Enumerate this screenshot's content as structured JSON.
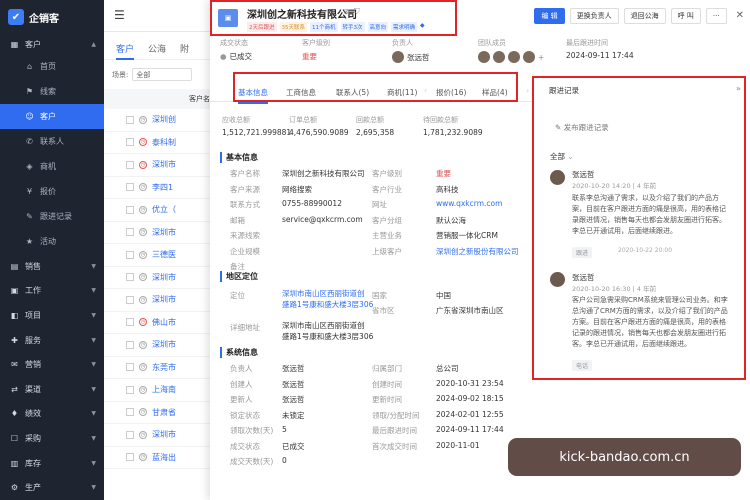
{
  "app": {
    "name": "企销客"
  },
  "sidebar": {
    "sections_top": [
      {
        "label": "客户"
      }
    ],
    "items": [
      {
        "label": "首页",
        "icon": "home-icon"
      },
      {
        "label": "线索",
        "icon": "lead-icon"
      },
      {
        "label": "客户",
        "icon": "customer-icon",
        "active": true
      },
      {
        "label": "联系人",
        "icon": "contact-icon"
      },
      {
        "label": "商机",
        "icon": "opportunity-icon"
      },
      {
        "label": "报价",
        "icon": "quote-icon"
      },
      {
        "label": "跟进记录",
        "icon": "followup-icon"
      },
      {
        "label": "活动",
        "icon": "event-icon"
      }
    ],
    "sections": [
      {
        "label": "销售",
        "icon": "sales-icon"
      },
      {
        "label": "工作",
        "icon": "work-icon"
      },
      {
        "label": "项目",
        "icon": "project-icon"
      },
      {
        "label": "服务",
        "icon": "service-icon"
      },
      {
        "label": "营销",
        "icon": "marketing-icon"
      },
      {
        "label": "渠道",
        "icon": "channel-icon"
      },
      {
        "label": "绩效",
        "icon": "performance-icon"
      },
      {
        "label": "采购",
        "icon": "purchase-icon"
      },
      {
        "label": "库存",
        "icon": "inventory-icon"
      },
      {
        "label": "生产",
        "icon": "production-icon"
      }
    ]
  },
  "list": {
    "tabs": [
      "客户",
      "公海",
      "附"
    ],
    "scene_label": "场景:",
    "scene_value": "全部",
    "header": "客户名",
    "rows": [
      "深圳创",
      "泰科制",
      "深圳市",
      "李四1",
      "优立（",
      "深圳市",
      "三德医",
      "深圳市",
      "深圳市",
      "佛山市",
      "深圳市",
      "东莞市",
      "上海南",
      "甘肃省",
      "深圳市",
      "蓝海出"
    ]
  },
  "detail": {
    "company": "深圳创之新科技有限公司",
    "tags": [
      {
        "text": "2天后跟进",
        "color": "#e05656",
        "bg": "#fdecec"
      },
      {
        "text": "35天联系",
        "color": "#e08a1e",
        "bg": "#fdf3e6"
      },
      {
        "text": "11个商机",
        "color": "#2f6cf0",
        "bg": "#e9f0fe"
      },
      {
        "text": "转手3次",
        "color": "#2f6cf0",
        "bg": "#e9f0fe"
      },
      {
        "text": "高意向",
        "color": "#2f6cf0",
        "bg": "#e9f0fe"
      },
      {
        "text": "需求明确",
        "color": "#2f6cf0",
        "bg": "#e9f0fe"
      }
    ],
    "buttons": {
      "edit": "编 辑",
      "change_owner": "更换负责人",
      "return_pool": "退回公海",
      "call": "呼 叫",
      "more": "···"
    },
    "summary": {
      "deal_status_label": "成交状态",
      "deal_status": "已成交",
      "level_label": "客户级别",
      "level": "重要",
      "owner_label": "负责人",
      "owner": "张远哲",
      "team_label": "团队成员",
      "last_follow_label": "最后跟进时间",
      "last_follow": "2024-09-11 17:44"
    },
    "tabs": [
      {
        "label": "基本信息",
        "active": true
      },
      {
        "label": "工商信息"
      },
      {
        "label": "联系人(5)"
      },
      {
        "label": "商机(11)"
      },
      {
        "label": "报价(16)"
      },
      {
        "label": "样品(4)"
      }
    ],
    "stats": [
      {
        "label": "应收总额",
        "value": "1,512,721.999881"
      },
      {
        "label": "订单总额",
        "value": "4,476,590.9089"
      },
      {
        "label": "回款总额",
        "value": "2,695,358"
      },
      {
        "label": "待回款总额",
        "value": "1,781,232.9089"
      }
    ],
    "basic_title": "基本信息",
    "basic": {
      "name_l": "客户名称",
      "name_v": "深圳创之新科技有限公司",
      "level_l": "客户级别",
      "level_v": "重要",
      "source_l": "客户来源",
      "source_v": "网络搜索",
      "industry_l": "客户行业",
      "industry_v": "高科技",
      "phone_l": "联系方式",
      "phone_v": "0755-88990012",
      "web_l": "网址",
      "web_v": "www.qxkcrm.com",
      "email_l": "邮箱",
      "email_v": "service@qxkcrm.com",
      "group_l": "客户分组",
      "group_v": "默认公海",
      "clue_l": "来源线索",
      "clue_v": "",
      "product_l": "主营业务",
      "product_v": "营销服一体化CRM",
      "enterprise_l": "企业规模",
      "enterprise_v": "",
      "parent_l": "上级客户",
      "parent_v": "深圳创之新股份有限公司",
      "remark_l": "备注",
      "remark_v": ""
    },
    "loc_title": "地区定位",
    "loc": {
      "pos_l": "定位",
      "pos_v1": "深圳市南山区西丽街道创",
      "pos_v2": "盛路1号康和盛大楼3层306",
      "country_l": "国家",
      "country_v": "中国",
      "region_l": "省市区",
      "region_v": "广东省深圳市南山区",
      "addr_l": "详细地址",
      "addr_v1": "深圳市南山区西丽街道创",
      "addr_v2": "盛路1号康和盛大楼3层306"
    },
    "sys_title": "系统信息",
    "sys": {
      "owner_l": "负责人",
      "owner_v": "张远哲",
      "dept_l": "归属部门",
      "dept_v": "总公司",
      "creator_l": "创建人",
      "creator_v": "张远哲",
      "created_l": "创建时间",
      "created_v": "2020-10-31 23:54",
      "updater_l": "更新人",
      "updater_v": "张远哲",
      "updated_l": "更新时间",
      "updated_v": "2024-09-02 18:15",
      "lock_l": "锁定状态",
      "lock_v": "未锁定",
      "assign_l": "领取/分配时间",
      "assign_v": "2024-02-01 12:55",
      "claim_l": "领取次数(天)",
      "claim_v": "5",
      "lastf_l": "最后跟进时间",
      "lastf_v": "2024-09-11 17:44",
      "deal_l": "成交状态",
      "deal_v": "已成交",
      "firstdeal_l": "首次成交时间",
      "firstdeal_v": "2020-11-01",
      "dealdays_l": "成交天数(天)",
      "dealdays_v": "0"
    },
    "follow": {
      "title": "跟进记录",
      "post": "发布跟进记录",
      "filter": "全部",
      "records": [
        {
          "name": "张远哲",
          "time": "2020-10-20 14:20 | 4 年前",
          "body": "联系李总沟通了需求，以及介绍了我们的产品方案，目前在客户跟进方面的痛是很高，用的表格记录跟进情况，销售每天也都会发朋友圈进行拓客。李总已开通试用，后面继续跟进。",
          "stamp": "2020-10-22 20:00",
          "chip": "跟进"
        },
        {
          "name": "张远哲",
          "time": "2020-10-20 16:30 | 4 年前",
          "body": "客户公司急需采购CRM系统来管理公司业务。和李总沟通了CRM方面的需求，以及介绍了我们的产品方案。目前在客户跟进方面的痛是很高，用的表格记录的跟进情况，销售每天也都会发朋友圈进行拓客。李总已开通试用，后面继续跟进。",
          "chip": "电话"
        }
      ]
    }
  },
  "watermark": "kick-bandao.com.cn"
}
